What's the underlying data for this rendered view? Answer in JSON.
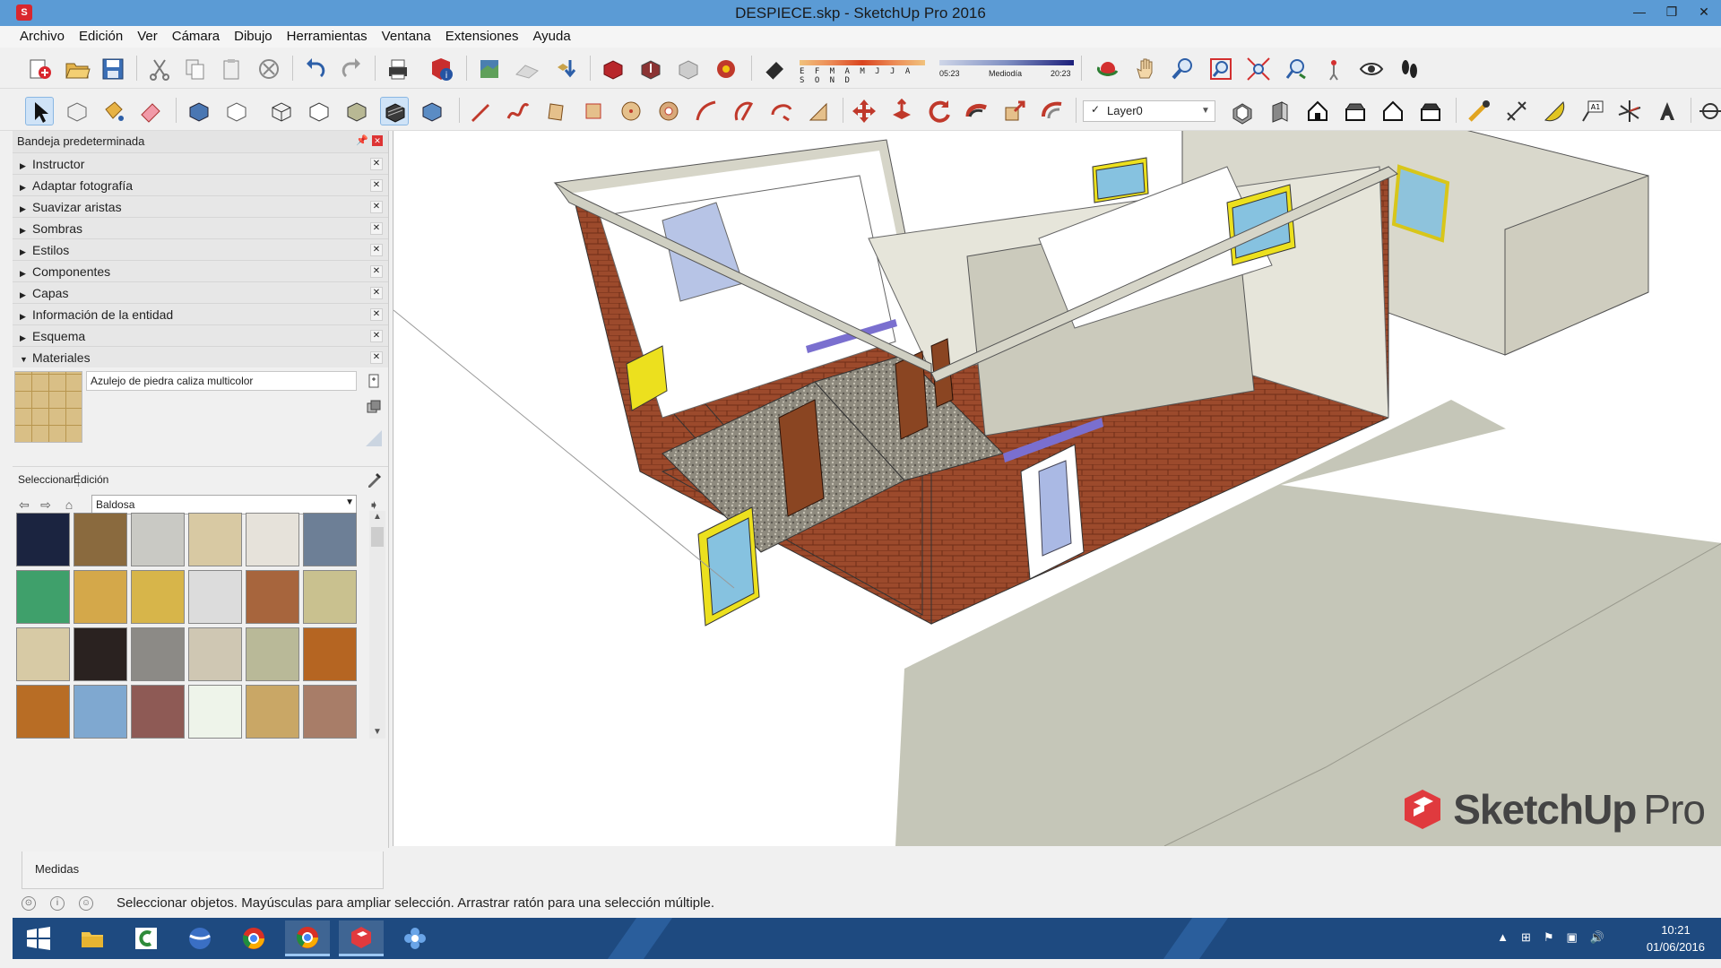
{
  "window": {
    "title": "DESPIECE.skp - SketchUp Pro 2016",
    "app_icon": "sketchup-icon",
    "controls": [
      "minimize",
      "restore",
      "close"
    ]
  },
  "menu": [
    "Archivo",
    "Edición",
    "Ver",
    "Cámara",
    "Dibujo",
    "Herramientas",
    "Ventana",
    "Extensiones",
    "Ayuda"
  ],
  "toolbar": {
    "shadow_months": "E F M A M J J A S O N D",
    "time_start": "05:23",
    "time_mid": "Mediodía",
    "time_end": "20:23",
    "layer": "Layer0",
    "layer_checked": true
  },
  "tray": {
    "title": "Bandeja predeterminada",
    "panels": [
      {
        "label": "Instructor",
        "expanded": false
      },
      {
        "label": "Adaptar fotografía",
        "expanded": false
      },
      {
        "label": "Suavizar aristas",
        "expanded": false
      },
      {
        "label": "Sombras",
        "expanded": false
      },
      {
        "label": "Estilos",
        "expanded": false
      },
      {
        "label": "Componentes",
        "expanded": false
      },
      {
        "label": "Capas",
        "expanded": false
      },
      {
        "label": "Información de la entidad",
        "expanded": false
      },
      {
        "label": "Esquema",
        "expanded": false
      },
      {
        "label": "Materiales",
        "expanded": true
      }
    ],
    "materials": {
      "current_name": "Azulejo de piedra caliza multicolor",
      "tabs": [
        "Seleccionar",
        "Edición"
      ],
      "active_tab": "Seleccionar",
      "collection": "Baldosa",
      "swatches": [
        "#1b2440",
        "#8a6a3e",
        "#c9c9c4",
        "#d8c9a3",
        "#e6e2da",
        "#6d7f96",
        "#3fa06b",
        "#d4a84a",
        "#d7b54a",
        "#dcdcdc",
        "#a7653d",
        "#c9c18f",
        "#d7caa5",
        "#2a2220",
        "#8c8a86",
        "#cfc7b3",
        "#b9b998",
        "#b56522",
        "#b86d25",
        "#7fa8d0",
        "#8e5a55",
        "#eef4ea",
        "#c9a766",
        "#a87d68"
      ]
    }
  },
  "measurements_label": "Medidas",
  "status": {
    "message": "Seleccionar objetos. Mayúsculas para ampliar selección. Arrastrar ratón para una selección múltiple."
  },
  "viewport": {
    "brand": "SketchUp",
    "brand_suffix": "Pro"
  },
  "taskbar": {
    "apps": [
      "windows-start",
      "file-explorer",
      "camtasia",
      "google-earth",
      "chrome",
      "chrome-remote",
      "sketchup",
      "flower-app"
    ],
    "time": "10:21",
    "date": "01/06/2016"
  }
}
